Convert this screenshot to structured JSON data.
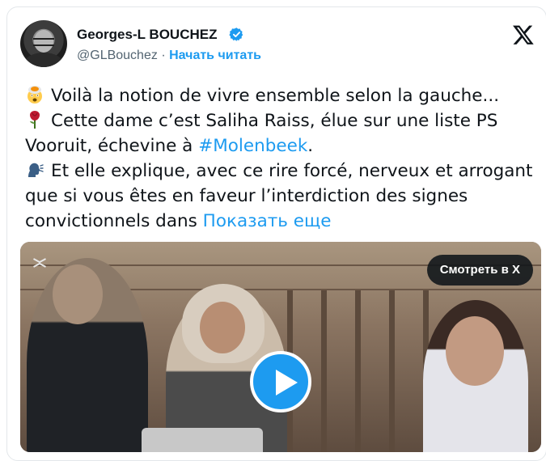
{
  "tweet": {
    "author_name": "Georges-L BOUCHEZ",
    "handle": "@GLBouchez",
    "separator": "·",
    "follow_label": "Начать читать",
    "line1": "Voilà la notion de vivre ensemble selon la gauche...",
    "line2": "Cette dame c’est Saliha Raiss, élue sur une liste PS",
    "line3_pre": "Vooruit, échevine à ",
    "hashtag": "#Molenbeek",
    "line3_post": ".",
    "line4": "Et elle explique, avec ce rire forcé, nerveux et arrogant",
    "line5": "que si vous êtes en faveur l’interdiction des signes",
    "line6_pre": "convictionnels dans ",
    "show_more": "Показать еще"
  },
  "video": {
    "watch_label": "Смотреть в X"
  },
  "icons": {
    "verified": "verified-badge-icon",
    "x_logo": "x-logo-icon",
    "emoji1": "exploding-head-emoji",
    "emoji2": "rose-emoji",
    "emoji3": "speaking-head-emoji",
    "play": "play-icon"
  },
  "colors": {
    "accent": "#1d9bf0",
    "text": "#0f1419",
    "muted": "#536471"
  }
}
